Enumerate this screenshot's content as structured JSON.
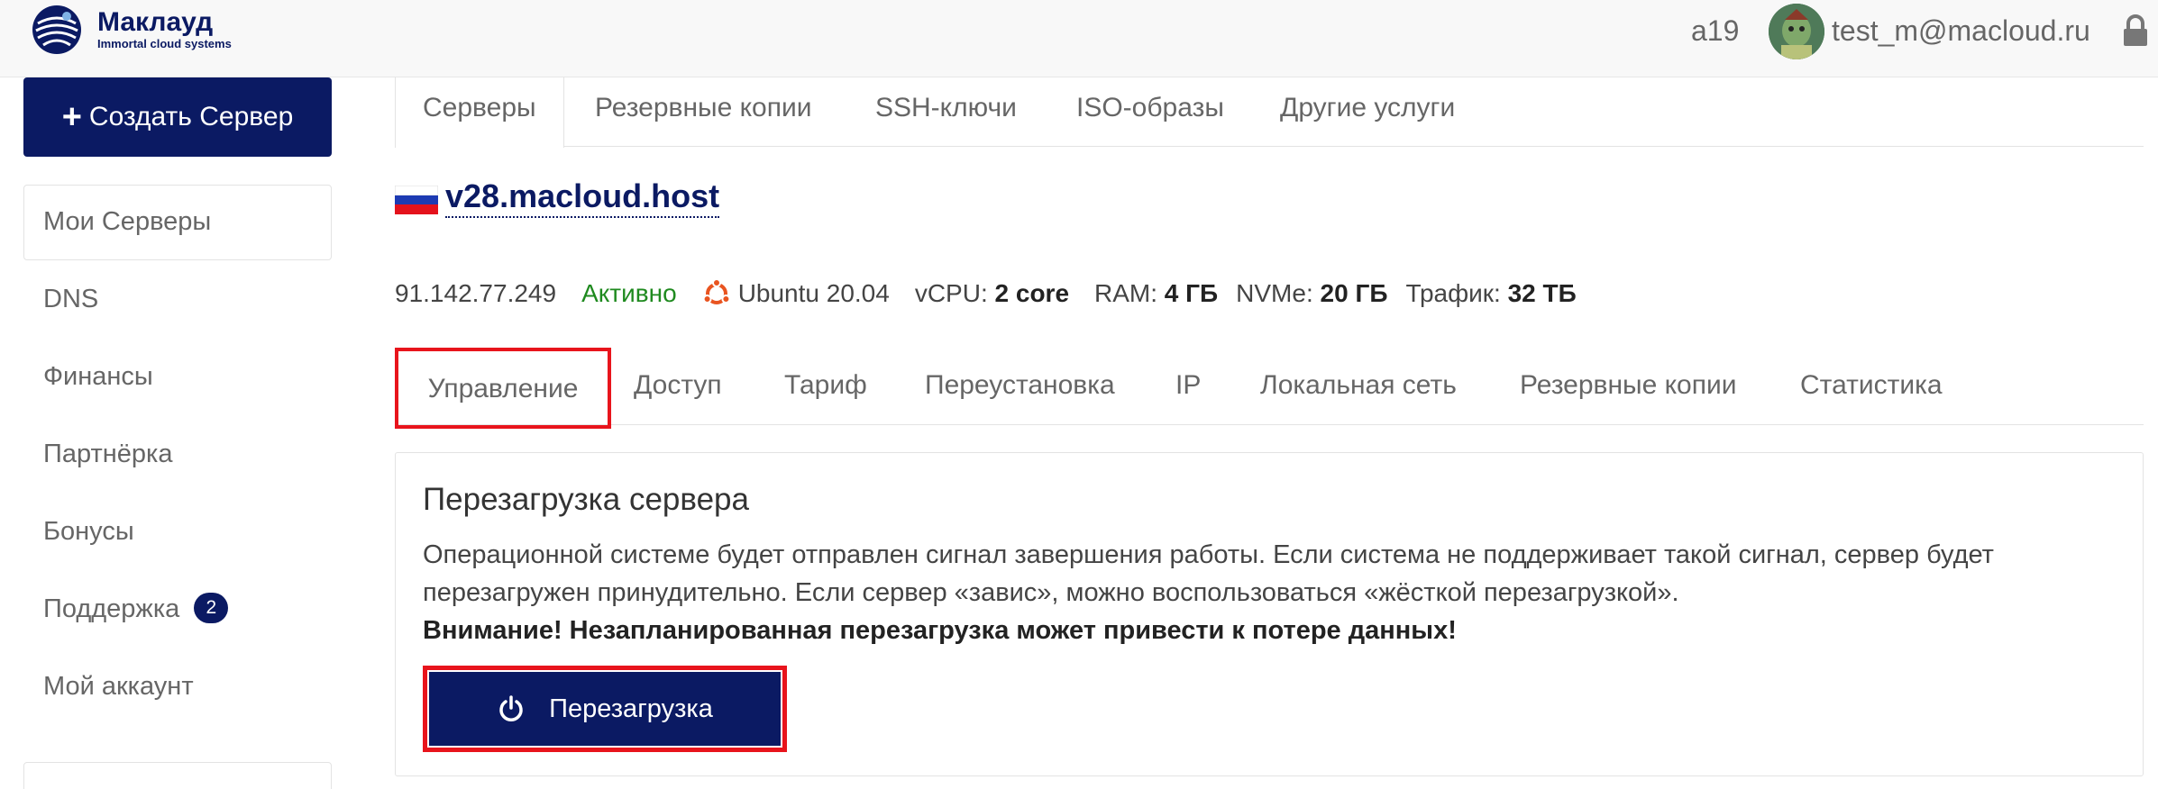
{
  "header": {
    "logo_name": "Маклауд",
    "logo_tagline": "Immortal cloud systems",
    "account_id": "a19",
    "user_email": "test_m@macloud.ru"
  },
  "sidebar": {
    "create_label": "Создать Сервер",
    "items": [
      {
        "label": "Мои Серверы"
      },
      {
        "label": "DNS"
      },
      {
        "label": "Финансы"
      },
      {
        "label": "Партнёрка"
      },
      {
        "label": "Бонусы"
      },
      {
        "label": "Поддержка",
        "badge": "2"
      },
      {
        "label": "Мой аккаунт"
      }
    ]
  },
  "top_tabs": [
    {
      "label": "Серверы"
    },
    {
      "label": "Резервные копии"
    },
    {
      "label": "SSH-ключи"
    },
    {
      "label": "ISO-образы"
    },
    {
      "label": "Другие услуги"
    }
  ],
  "server": {
    "name": "v28.macloud.host",
    "ip": "91.142.77.249",
    "status": "Активно",
    "os": "Ubuntu 20.04",
    "vcpu_label": "vCPU:",
    "vcpu_value": "2 core",
    "ram_label": "RAM:",
    "ram_value": "4 ГБ",
    "nvme_label": "NVMe:",
    "nvme_value": "20 ГБ",
    "traffic_label": "Трафик:",
    "traffic_value": "32 ТБ"
  },
  "sub_tabs": [
    {
      "label": "Управление"
    },
    {
      "label": "Доступ"
    },
    {
      "label": "Тариф"
    },
    {
      "label": "Переустановка"
    },
    {
      "label": "IP"
    },
    {
      "label": "Локальная сеть"
    },
    {
      "label": "Резервные копии"
    },
    {
      "label": "Статистика"
    }
  ],
  "panel": {
    "title": "Перезагрузка сервера",
    "text": "Операционной системе будет отправлен сигнал завершения работы. Если система не поддерживает такой сигнал, сервер будет перезагружен принудительно. Если сервер «завис», можно воспользоваться «жёсткой перезагрузкой».",
    "warning": "Внимание! Незапланированная перезагрузка может привести к потере данных!",
    "button_label": "Перезагрузка"
  },
  "colors": {
    "brand": "#0b1a63",
    "highlight": "#e8141c",
    "status_active": "#1f8a1f"
  },
  "icons": [
    "logo-icon",
    "avatar",
    "lock-icon",
    "plus-icon",
    "russia-flag-icon",
    "ubuntu-icon",
    "power-icon"
  ]
}
